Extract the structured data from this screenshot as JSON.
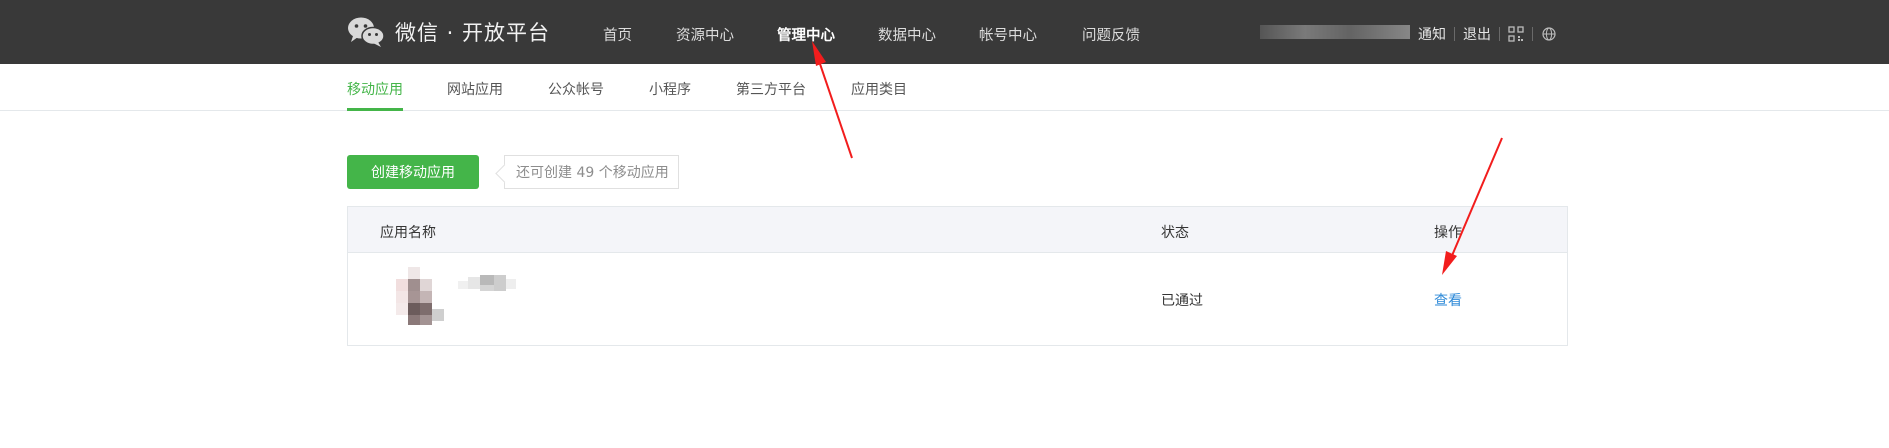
{
  "header": {
    "brand": "微信 · 开放平台",
    "nav": [
      {
        "label": "首页",
        "active": false
      },
      {
        "label": "资源中心",
        "active": false
      },
      {
        "label": "管理中心",
        "active": true
      },
      {
        "label": "数据中心",
        "active": false
      },
      {
        "label": "帐号中心",
        "active": false
      },
      {
        "label": "问题反馈",
        "active": false
      }
    ],
    "notify_label": "通知",
    "logout_label": "退出",
    "icons": [
      "wechat-logo-icon",
      "qr-code-icon",
      "globe-icon"
    ]
  },
  "subnav": {
    "tabs": [
      {
        "label": "移动应用",
        "active": true
      },
      {
        "label": "网站应用",
        "active": false
      },
      {
        "label": "公众帐号",
        "active": false
      },
      {
        "label": "小程序",
        "active": false
      },
      {
        "label": "第三方平台",
        "active": false
      },
      {
        "label": "应用类目",
        "active": false
      }
    ]
  },
  "actions": {
    "create_label": "创建移动应用",
    "remaining_tip": "还可创建 49 个移动应用"
  },
  "table": {
    "columns": [
      "应用名称",
      "状态",
      "操作"
    ],
    "rows": [
      {
        "status": "已通过",
        "action": "查看"
      }
    ]
  },
  "colors": {
    "topbar": "#393939",
    "accent_green": "#44b549",
    "link_blue": "#2e8ad8",
    "annotation_red": "#f21d1d"
  }
}
